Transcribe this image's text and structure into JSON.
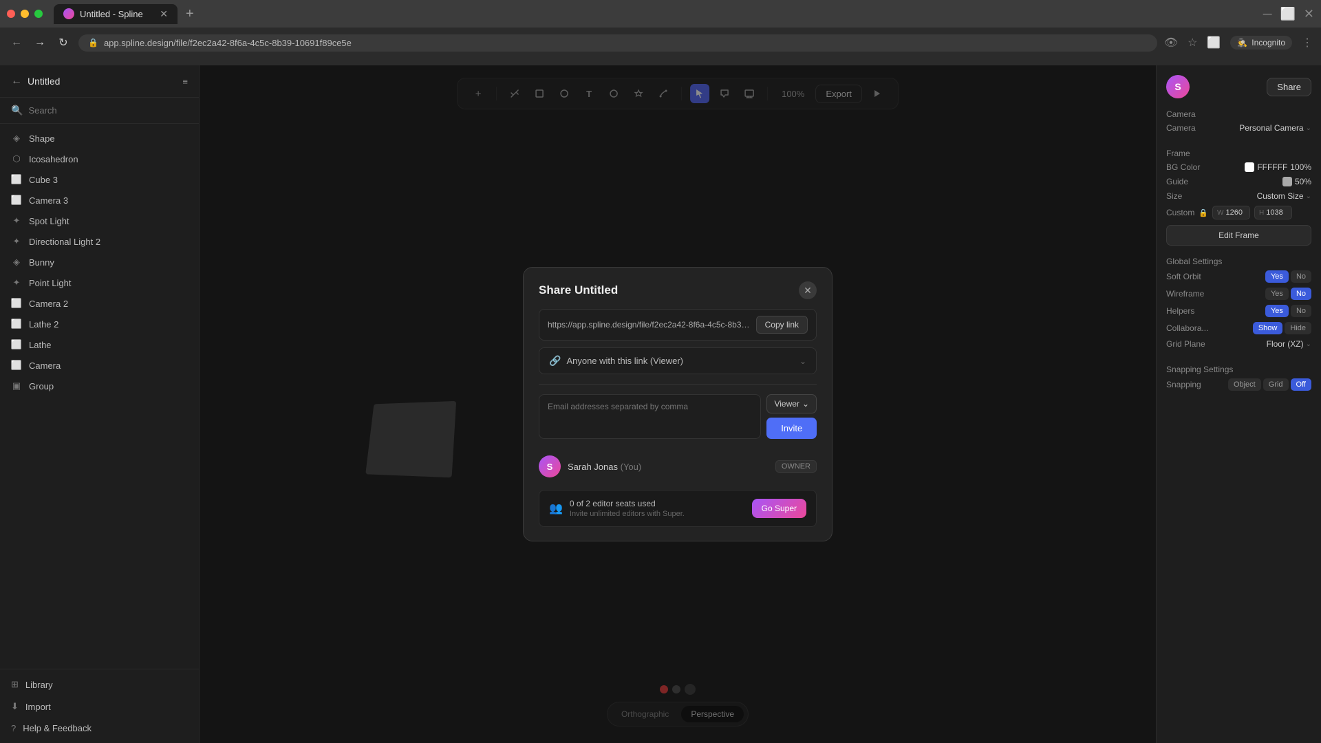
{
  "browser": {
    "tab_title": "Untitled - Spline",
    "new_tab_label": "+",
    "address": "app.spline.design/file/f2ec2a42-8f6a-4c5c-8b39-10691f89ce5e",
    "incognito_label": "Incognito"
  },
  "sidebar": {
    "title": "Untitled",
    "search_placeholder": "Search",
    "items": [
      {
        "id": "shape",
        "label": "Shape",
        "icon": "◈"
      },
      {
        "id": "icosahedron",
        "label": "Icosahedron",
        "icon": "⬡"
      },
      {
        "id": "cube3",
        "label": "Cube 3",
        "icon": "⬜"
      },
      {
        "id": "camera3",
        "label": "Camera 3",
        "icon": "📷"
      },
      {
        "id": "spot-light",
        "label": "Spot Light",
        "icon": "💡"
      },
      {
        "id": "dir-light2",
        "label": "Directional Light 2",
        "icon": "☀"
      },
      {
        "id": "bunny",
        "label": "Bunny",
        "icon": "◈"
      },
      {
        "id": "point-light",
        "label": "Point Light",
        "icon": "💡"
      },
      {
        "id": "camera2",
        "label": "Camera 2",
        "icon": "📷"
      },
      {
        "id": "lathe2",
        "label": "Lathe 2",
        "icon": "⬜"
      },
      {
        "id": "lathe",
        "label": "Lathe",
        "icon": "⬜"
      },
      {
        "id": "camera",
        "label": "Camera",
        "icon": "📷"
      },
      {
        "id": "group",
        "label": "Group",
        "icon": "▣"
      }
    ],
    "footer_items": [
      {
        "id": "library",
        "label": "Library",
        "icon": "⊞"
      },
      {
        "id": "import",
        "label": "Import",
        "icon": "⬇"
      },
      {
        "id": "help",
        "label": "Help & Feedback",
        "icon": "?"
      }
    ]
  },
  "toolbar": {
    "zoom_label": "100%",
    "export_label": "Export",
    "tools": [
      {
        "id": "add",
        "icon": "+",
        "active": false
      },
      {
        "id": "pen",
        "icon": "✦",
        "active": false
      },
      {
        "id": "rect",
        "icon": "▭",
        "active": false
      },
      {
        "id": "circle",
        "icon": "○",
        "active": false
      },
      {
        "id": "text",
        "icon": "T",
        "active": false
      },
      {
        "id": "blob",
        "icon": "⌘",
        "active": false
      },
      {
        "id": "star",
        "icon": "✿",
        "active": false
      },
      {
        "id": "path",
        "icon": "✎",
        "active": false
      },
      {
        "id": "select",
        "icon": "▲",
        "active": true
      },
      {
        "id": "comment",
        "icon": "💬",
        "active": false
      },
      {
        "id": "screen",
        "icon": "⬜",
        "active": false
      }
    ]
  },
  "view_toggle": {
    "orthographic_label": "Orthographic",
    "perspective_label": "Perspective",
    "active": "perspective"
  },
  "right_panel": {
    "user_initial": "S",
    "share_label": "Share",
    "camera_section": "Camera",
    "camera_type_label": "Camera",
    "camera_type_value": "Personal Camera",
    "frame_section": "Frame",
    "bg_color_label": "BG Color",
    "bg_color_hex": "FFFFFF",
    "bg_color_opacity": "100%",
    "guide_label": "Guide",
    "guide_value": "50%",
    "size_label": "Size",
    "size_value": "Custom Size",
    "custom_label": "Custom",
    "width_label": "W",
    "width_value": "1260",
    "height_label": "H",
    "height_value": "1038",
    "edit_frame_label": "Edit Frame",
    "global_settings_section": "Global Settings",
    "soft_orbit_label": "Soft Orbit",
    "soft_orbit_yes": "Yes",
    "soft_orbit_no": "No",
    "soft_orbit_active": "yes",
    "wireframe_label": "Wireframe",
    "wireframe_yes": "Yes",
    "wireframe_no": "No",
    "wireframe_active": "no",
    "helpers_label": "Helpers",
    "helpers_yes": "Yes",
    "helpers_no": "No",
    "helpers_active": "yes",
    "collabora_label": "Collabora...",
    "collabora_show": "Show",
    "collabora_hide": "Hide",
    "collabora_active": "show",
    "grid_plane_label": "Grid Plane",
    "grid_plane_value": "Floor (XZ)",
    "snapping_section": "Snapping Settings",
    "snapping_label": "Snapping",
    "snapping_object": "Object",
    "snapping_grid": "Grid",
    "snapping_off": "Off",
    "snapping_active": "off"
  },
  "modal": {
    "title": "Share Untitled",
    "link_url": "https://app.spline.design/file/f2ec2a42-8f6a-4c5c-8b39-...",
    "copy_link_label": "Copy link",
    "access_label": "Anyone with this link (Viewer)",
    "email_placeholder": "Email addresses separated by comma",
    "viewer_label": "Viewer",
    "invite_label": "Invite",
    "member_initial": "S",
    "member_name": "Sarah Jonas",
    "member_you": "(You)",
    "member_badge": "OWNER",
    "seats_used": "0 of 2 editor seats used",
    "seats_subtext": "Invite unlimited editors with Super.",
    "go_super_label": "Go Super"
  }
}
